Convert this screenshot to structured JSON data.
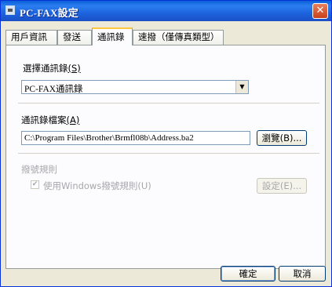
{
  "window": {
    "title": "PC-FAX設定",
    "close_label": "✕"
  },
  "tabs": [
    {
      "label": "用戶資訊",
      "active": false
    },
    {
      "label": "發送",
      "active": false
    },
    {
      "label": "通訊錄",
      "active": true
    },
    {
      "label": "速撥（僅傳真類型）",
      "active": false
    }
  ],
  "addressbook_select": {
    "label": "選擇通訊錄",
    "shortcut": "(S)",
    "value": "PC-FAX通訊錄"
  },
  "addressbook_file": {
    "label": "通訊錄檔案",
    "shortcut": "(A)",
    "value": "C:\\Program Files\\Brother\\Brmfl08b\\Address.ba2",
    "browse_label": "瀏覽(B)..."
  },
  "dialing_rules": {
    "heading": "撥號規則",
    "checkbox_label": "使用Windows撥號規則(U)",
    "checked": true,
    "settings_label": "設定(E)..."
  },
  "footer": {
    "ok_label": "確定",
    "cancel_label": "取消"
  }
}
